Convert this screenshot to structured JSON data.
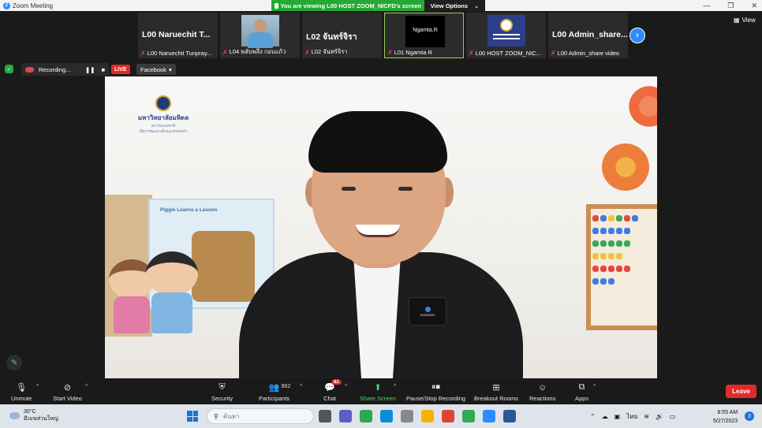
{
  "window": {
    "title": "Zoom Meeting",
    "logo_letter": "Z",
    "controls": [
      "—",
      "❐",
      "✕"
    ]
  },
  "share_banner": {
    "message": "You are viewing L00 HOST ZOOM_NICFD's screen",
    "options_label": "View Options",
    "options_caret": "⌄"
  },
  "thumbnails": [
    {
      "big_label": "L00 Naruechit T...",
      "caption": "L00 Naruechit Tunpray...",
      "kind": "name"
    },
    {
      "big_label": "",
      "caption": "L04 พลับพลึง กอบแก้ว",
      "kind": "photo"
    },
    {
      "big_label": "L02 จันทร์จิรา",
      "caption": "L02 จันทร์จิรา",
      "kind": "name"
    },
    {
      "big_label": "",
      "caption": "L01 Ngamta R",
      "kind": "black",
      "box_text": "Ngamta.R"
    },
    {
      "big_label": "",
      "caption": "L00 HOST ZOOM_NIC...",
      "kind": "logo"
    },
    {
      "big_label": "L00 Admin_share...",
      "caption": "L00 Admin_share video",
      "kind": "name"
    }
  ],
  "view_label": "View",
  "next_glyph": "›",
  "recording": {
    "status": "Recording...",
    "pause_glyph": "❚❚",
    "stop_glyph": "■",
    "live_label": "LIVE",
    "platform": "Facebook",
    "platform_caret": "▾"
  },
  "video": {
    "brand_title": "มหาวิทยาลัยมหิดล",
    "brand_sub1": "สถาบันแห่งชาติ",
    "brand_sub2": "เพื่อการพัฒนาเด็กและครอบครัว",
    "book_title": "Piggie Learns a Lesson",
    "mic_label": "GOGOGO"
  },
  "toolbar": {
    "unmute": "Unmute",
    "start_video": "Start Video",
    "security": "Security",
    "participants": "Participants",
    "participants_count": "862",
    "chat": "Chat",
    "chat_badge": "82",
    "share_screen": "Share Screen",
    "pause_stop": "Pause/Stop Recording",
    "breakout": "Breakout Rooms",
    "reactions": "Reactions",
    "apps": "Apps",
    "leave": "Leave",
    "caret": "^"
  },
  "taskbar": {
    "temperature": "30°C",
    "weather_desc": "มีเมฆส่วนใหญ่",
    "search_placeholder": "ค้นหา",
    "language": "ไทย",
    "time": "8:55 AM",
    "date": "5/27/2023",
    "notifications": "3",
    "colors": {
      "accent": "#1a73d9"
    }
  }
}
